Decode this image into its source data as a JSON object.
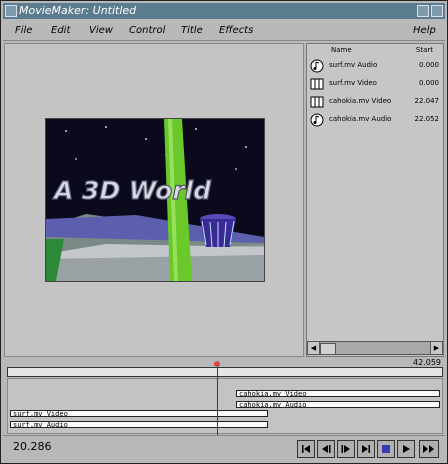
{
  "window": {
    "title": "MovieMaker: Untitled"
  },
  "menu": {
    "items": [
      "File",
      "Edit",
      "View",
      "Control",
      "Title",
      "Effects",
      "Help"
    ]
  },
  "preview": {
    "text": "A 3D World"
  },
  "clips": {
    "headers": [
      "Name",
      "Start"
    ],
    "items": [
      {
        "name": "surf.mv Audio",
        "start": "0.000",
        "type": "audio"
      },
      {
        "name": "surf.mv Video",
        "start": "0.000",
        "type": "video"
      },
      {
        "name": "cahokia.mv Video",
        "start": "22.047",
        "type": "video"
      },
      {
        "name": "cahokia.mv Audio",
        "start": "22.052",
        "type": "audio"
      }
    ]
  },
  "timeline": {
    "end_time": "42.059",
    "tracks": [
      "cahokia.mv Video",
      "cahokia.mv Audio",
      "surf.mv Video",
      "surf.mv Audio"
    ]
  },
  "transport": {
    "current_time": "20.286"
  },
  "colors": {
    "titlebar": "#5b7b8f",
    "playhead": "#cc0000",
    "stop_active": "#3b3bb0"
  }
}
